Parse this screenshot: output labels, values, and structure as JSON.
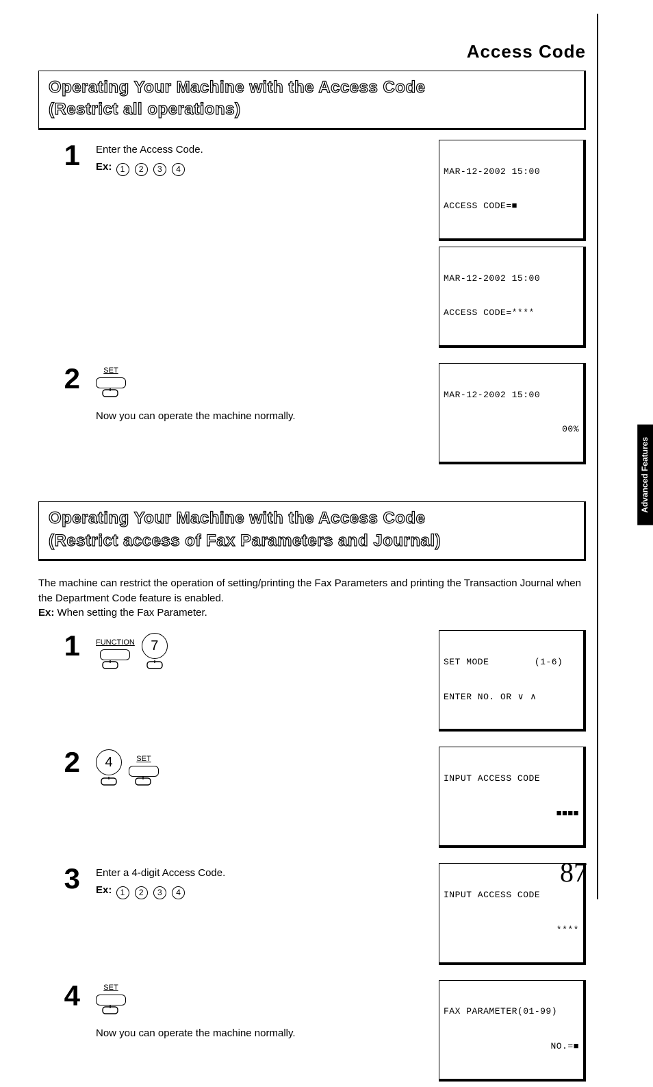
{
  "page_title": "Access Code",
  "section_a": {
    "heading_line1": "Operating Your Machine with the Access Code",
    "heading_line2": "(Restrict all operations)",
    "steps": {
      "s1": {
        "num": "1",
        "line1": "Enter the Access Code.",
        "ex_label": "Ex:",
        "ex_digits": [
          "1",
          "2",
          "3",
          "4"
        ],
        "lcd1_l1": "MAR-12-2002 15:00",
        "lcd1_l2": "ACCESS CODE=■",
        "lcd2_l1": "MAR-12-2002 15:00",
        "lcd2_l2": "ACCESS CODE=****"
      },
      "s2": {
        "num": "2",
        "key_label": "SET",
        "after": "Now you can operate the machine normally.",
        "lcd_l1": "MAR-12-2002 15:00",
        "lcd_l2": "00%"
      }
    }
  },
  "section_b": {
    "heading_line1": "Operating Your Machine with the Access Code",
    "heading_line2": "(Restrict access of Fax Parameters and Journal)",
    "intro": "The machine can restrict the operation of setting/printing the Fax Parameters and printing the Transaction Journal when the Department Code feature is enabled.",
    "intro_ex_label": "Ex:",
    "intro_ex_text": " When setting the Fax Parameter.",
    "steps": {
      "s1": {
        "num": "1",
        "key_label": "FUNCTION",
        "digit": "7",
        "lcd_l1": "SET MODE        (1-6)",
        "lcd_l2": "ENTER NO. OR ∨ ∧"
      },
      "s2": {
        "num": "2",
        "digit": "4",
        "key_label": "SET",
        "lcd_l1": "INPUT ACCESS CODE",
        "lcd_l2": "■■■■"
      },
      "s3": {
        "num": "3",
        "line1": "Enter a 4-digit Access Code.",
        "ex_label": "Ex:",
        "ex_digits": [
          "1",
          "2",
          "3",
          "4"
        ],
        "lcd_l1": "INPUT ACCESS CODE",
        "lcd_l2": "****"
      },
      "s4": {
        "num": "4",
        "key_label": "SET",
        "after": "Now you can operate the machine normally.",
        "lcd_l1": "FAX PARAMETER(01-99)",
        "lcd_l2": "NO.=■"
      }
    }
  },
  "sidebar": "Advanced Features",
  "page_number": "87"
}
